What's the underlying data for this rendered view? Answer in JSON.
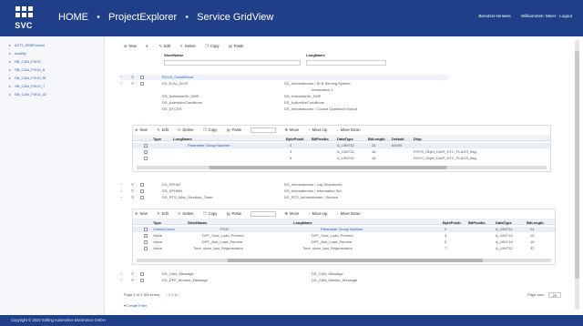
{
  "header": {
    "logo_text": "SVC",
    "crumbs": [
      "HOME",
      "ProjectExplorer",
      "Service GridView"
    ],
    "separator": "•",
    "user_links": [
      "Benutzer-Hinweis",
      "Willkommen: Meier · Logout"
    ]
  },
  "sidebar": {
    "items": [
      {
        "label": "ACTI_SEMControl"
      },
      {
        "label": "Activity"
      },
      {
        "label": "SB_CAN_FIXIO"
      },
      {
        "label": "SB_CAN_FIXIO_8"
      },
      {
        "label": "SB_CAN_FIXIO_M"
      },
      {
        "label": "SB_CAN_FIXIO_T"
      },
      {
        "label": "SB_CAN_FIXIO_ID"
      }
    ]
  },
  "toolbar1": {
    "new": "New",
    "edit": "Edit",
    "delete": "Delete",
    "copy": "Copy",
    "paste": "Paste"
  },
  "grid1": {
    "col_shortname": "ShortName",
    "col_longname": "LongName",
    "rows": [
      {
        "short": "ECUS_CanWithout",
        "long": ""
      },
      {
        "short": "DS_ECU_DIOS",
        "long": "DS_Informationen / ID B Serving System"
      },
      {
        "short": "",
        "long": "Information 1"
      },
      {
        "short": "DS_AdministrSe_DMS",
        "long": "DS_AdministrSe_DMS"
      },
      {
        "short": "DS_ActiveAreConditions",
        "long": "DS_ActiveAreConditions"
      },
      {
        "short": "DS_DTCDS",
        "long": "DS_Informationen / Ccount Operation Output"
      }
    ]
  },
  "toolbar2": {
    "new": "New",
    "edit": "Edit",
    "delete": "Delete",
    "copy": "Copy",
    "paste": "Paste",
    "move": "Move",
    "moveup": "Move Up",
    "movedown": "Move Down"
  },
  "grid2": {
    "cols": [
      "Type",
      "LongName",
      "BytePositi",
      "BitPositio",
      "DataType",
      "BitLength",
      "Default",
      "Disp"
    ],
    "rows": [
      {
        "type": "",
        "long": "Parameter Group Number",
        "byte": "0",
        "bit": "",
        "dtype": "A_UINT32",
        "len": "24",
        "def": "64000",
        "disp": ""
      },
      {
        "type": "",
        "long": "",
        "byte": "3",
        "bit": "",
        "dtype": "A_UINT32",
        "len": "16",
        "def": "",
        "disp": "PHYS_Objet_DIAP_DTC_FLAGS_flag"
      },
      {
        "type": "",
        "long": "",
        "byte": "5",
        "bit": "",
        "dtype": "A_UINT32",
        "len": "16",
        "def": "",
        "disp": "PHYS_Objet_DIAP_DTC_FLAGS_flag"
      }
    ]
  },
  "grid1b": {
    "rows": [
      {
        "short": "DS_SPHAT",
        "long": "DS_Informationen / Log Sequences"
      },
      {
        "short": "DS_SPHMD",
        "long": "DS_Informationen / Information Set"
      },
      {
        "short": "DS_RTS_Misc_Readout_Timer",
        "long": "DS_RTS_Informationen / Service"
      }
    ]
  },
  "toolbar3": {
    "new": "New",
    "edit": "Edit",
    "delete": "Delete",
    "copy": "Copy",
    "paste": "Paste",
    "move": "Move",
    "moveup": "Move Up",
    "movedown": "Move Down"
  },
  "grid3": {
    "cols": [
      "Type",
      "ShortName",
      "LongName",
      "BytePositi",
      "BitPositio",
      "DataType",
      "BitLength"
    ],
    "rows": [
      {
        "type": "Coded-Const",
        "short": "PGN",
        "long": "Parameter Group Number",
        "byte": "0",
        "dtype": "A_UINT32",
        "len": "24"
      },
      {
        "type": "Value",
        "short": "DPF_Soot_Load_Percent",
        "long": "DPF_Soot_Load_Percent",
        "byte": "3",
        "dtype": "A_UINT16",
        "len": "16"
      },
      {
        "type": "Value",
        "short": "DPF_Ash_Load_Percent",
        "long": "DPF_Ash_Load_Percent",
        "byte": "5",
        "dtype": "A_UINT16",
        "len": "16"
      },
      {
        "type": "Value",
        "short": "Time_since_last_Regeneration",
        "long": "Time_since_last_Regeneration",
        "byte": "7",
        "dtype": "A_UINT32",
        "len": "32"
      }
    ]
  },
  "grid1c": {
    "rows": [
      {
        "short": "DS_CAN_Message",
        "long": "DS_CAN_Message"
      },
      {
        "short": "DS_DPF_Monitor_Message",
        "long": "DS_CAN_Monitor_Message"
      }
    ]
  },
  "pager": {
    "info": "Page 1 of 3 (53 items)",
    "nav": "‹ 1 2 3 ›",
    "page_size_label": "Page size:",
    "page_size": "20"
  },
  "create_filter": "Create Filter",
  "footer": {
    "text": "Copyright © 2020 Softing Automotive Electronics GmbH"
  }
}
